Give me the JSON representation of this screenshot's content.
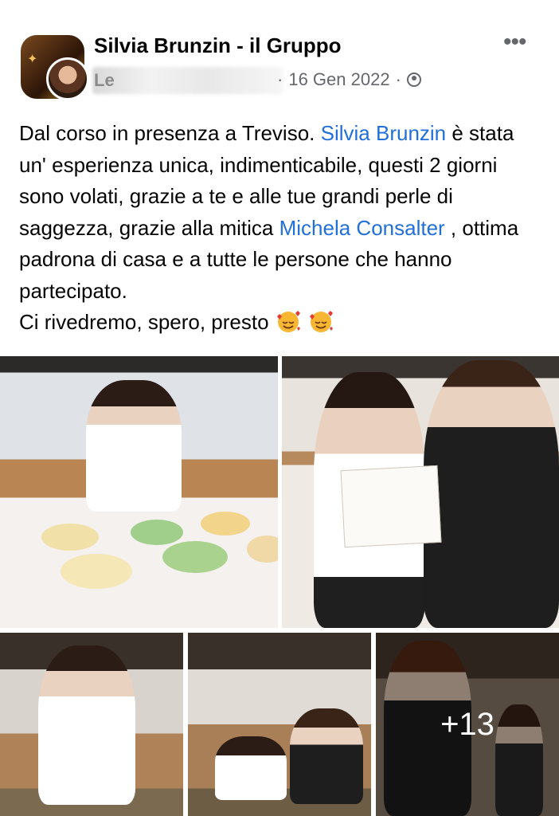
{
  "post": {
    "group_name": "Silvia Brunzin - il Gruppo",
    "author_initial": "Le",
    "date": "16 Gen 2022",
    "separator": "·",
    "privacy_icon": "group-icon",
    "more_icon": "more-dots-icon",
    "text": {
      "part1": "Dal corso in presenza a Treviso. ",
      "mention1": "Silvia Brunzin",
      "part2": " è stata un' esperienza unica, indimenticabile, questi 2 giorni sono volati, grazie a te e alle tue grandi perle di saggezza, grazie alla mitica ",
      "mention2": "Michela Consalter",
      "part3": " , ottima padrona di casa e a tutte le persone che hanno partecipato.",
      "part4": "Ci rivedremo, spero, presto",
      "emoji": "smiling-face-with-hearts-icon"
    }
  },
  "photos": {
    "more_count": "+13"
  },
  "colors": {
    "link": "#216fdb",
    "meta": "#65676b",
    "text": "#050505"
  }
}
